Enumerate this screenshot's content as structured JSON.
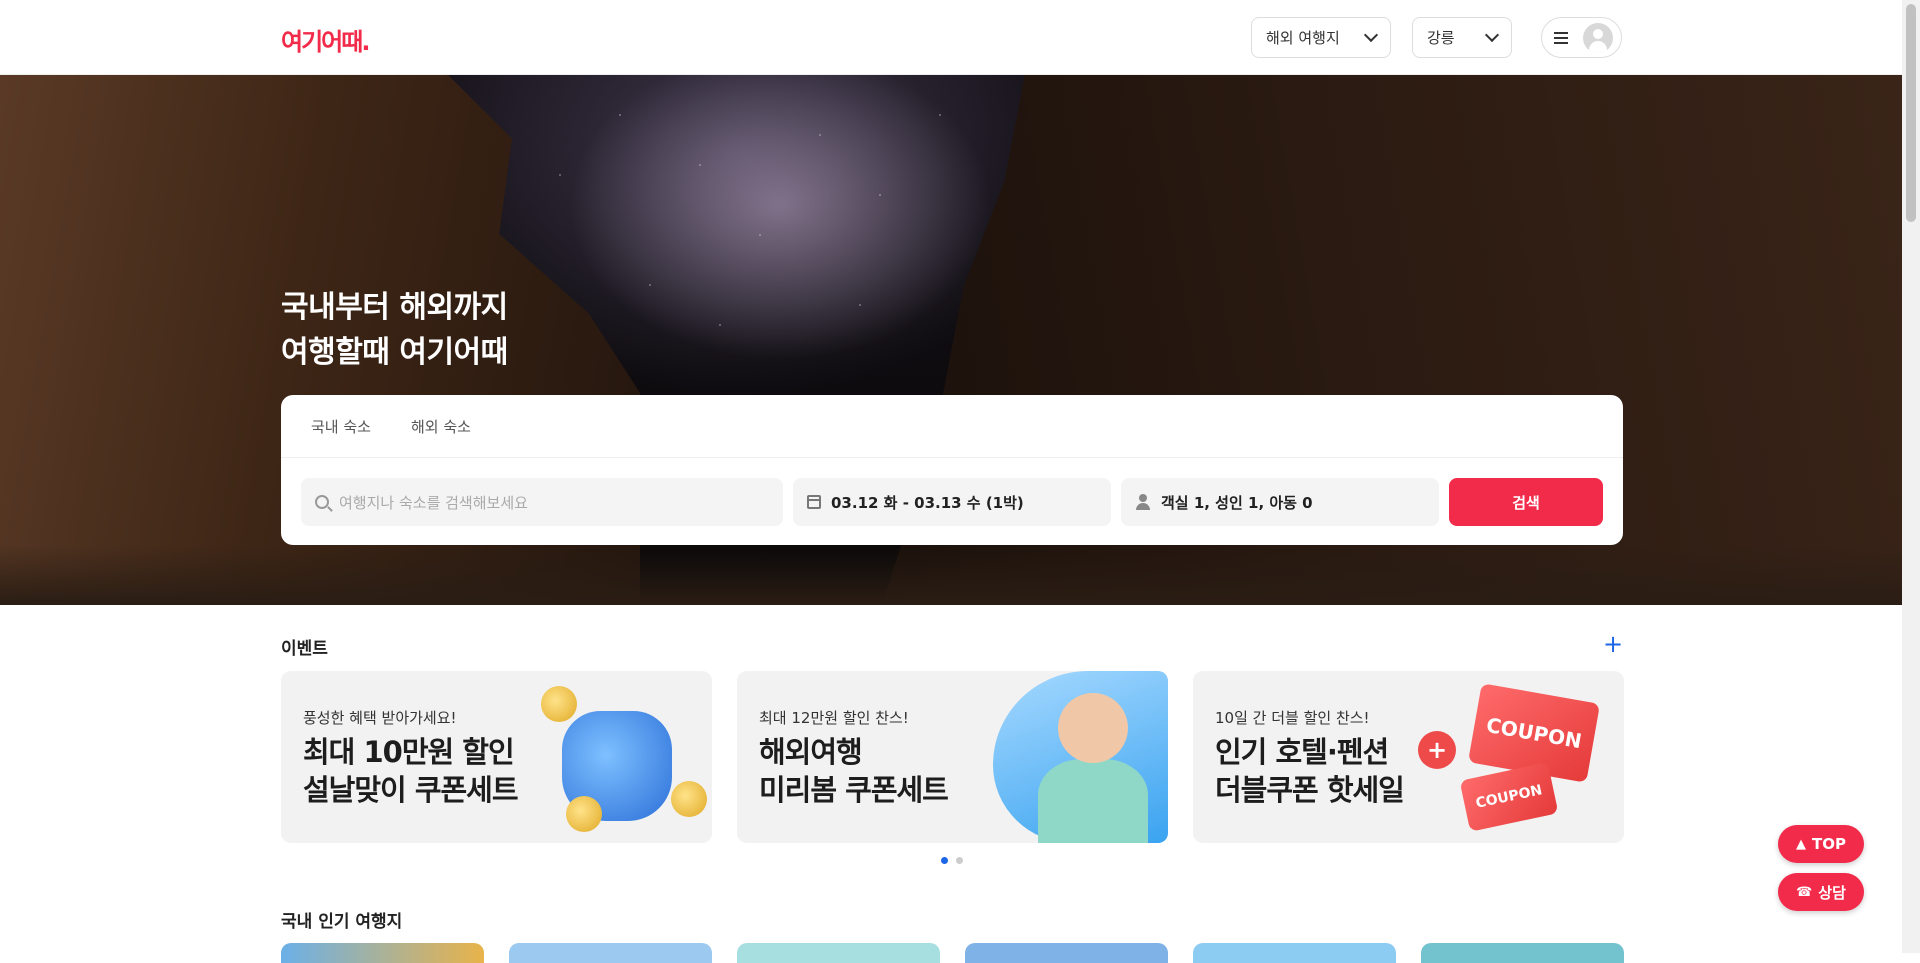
{
  "header": {
    "logo": "여기어때.",
    "region_select": "해외 여행지",
    "city_select": "강릉"
  },
  "hero": {
    "title_line1": "국내부터 해외까지",
    "title_line2": "여행할때 여기어때"
  },
  "search": {
    "tabs": [
      "국내 숙소",
      "해외 숙소"
    ],
    "destination_placeholder": "여행지나 숙소를 검색해보세요",
    "dates": "03.12 화 - 03.13 수 (1박)",
    "guests": "객실 1, 성인 1, 아동 0",
    "search_button": "검색"
  },
  "events": {
    "title": "이벤트",
    "more_icon": "plus-icon",
    "cards": [
      {
        "subtitle": "풍성한 혜택 받아가세요!",
        "line1": "최대 10만원 할인",
        "line2": "설날맞이 쿠폰세트"
      },
      {
        "subtitle": "최대 12만원 할인 찬스!",
        "line1": "해외여행",
        "line2": "미리봄 쿠폰세트"
      },
      {
        "subtitle": "10일 간 더블 할인 찬스!",
        "line1": "인기 호텔·펜션",
        "line2": "더블쿠폰 핫세일",
        "coupon_big": "COUPON",
        "coupon_small": "COUPON"
      }
    ],
    "page_indicator": {
      "current": 1,
      "total": 2
    }
  },
  "popular": {
    "title": "국내 인기 여행지"
  },
  "floating": {
    "top_label": "TOP",
    "chat_label": "상담"
  },
  "colors": {
    "brand": "#f22b4b",
    "link": "#1a66e6"
  }
}
